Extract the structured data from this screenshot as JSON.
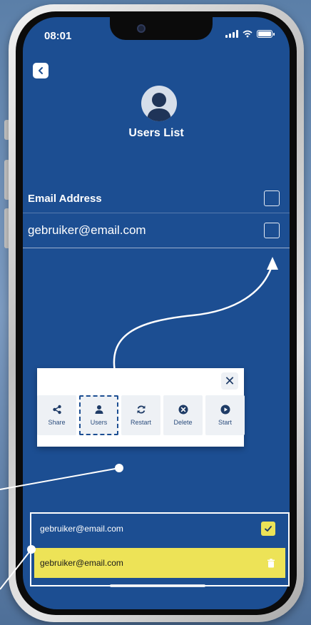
{
  "status_bar": {
    "time": "08:01"
  },
  "page": {
    "title": "Users List"
  },
  "list": {
    "header_label": "Email Address",
    "rows": [
      {
        "email": "gebruiker@email.com"
      }
    ]
  },
  "popup": {
    "close_label": "✕",
    "actions": [
      {
        "label": "Share",
        "icon": "share-icon"
      },
      {
        "label": "Users",
        "icon": "user-icon",
        "selected": true
      },
      {
        "label": "Restart",
        "icon": "refresh-icon"
      },
      {
        "label": "Delete",
        "icon": "delete-circle-icon"
      },
      {
        "label": "Start",
        "icon": "play-circle-icon"
      }
    ]
  },
  "bottom_panel": {
    "rows": [
      {
        "email": "gebruiker@email.com",
        "checked": true
      },
      {
        "email": "gebruiker@email.com",
        "highlighted": true,
        "icon": "trash-icon"
      }
    ]
  },
  "colors": {
    "screen_bg": "#1c4e92",
    "highlight_yellow": "#ede357",
    "icon_blue": "#1e3b66"
  }
}
